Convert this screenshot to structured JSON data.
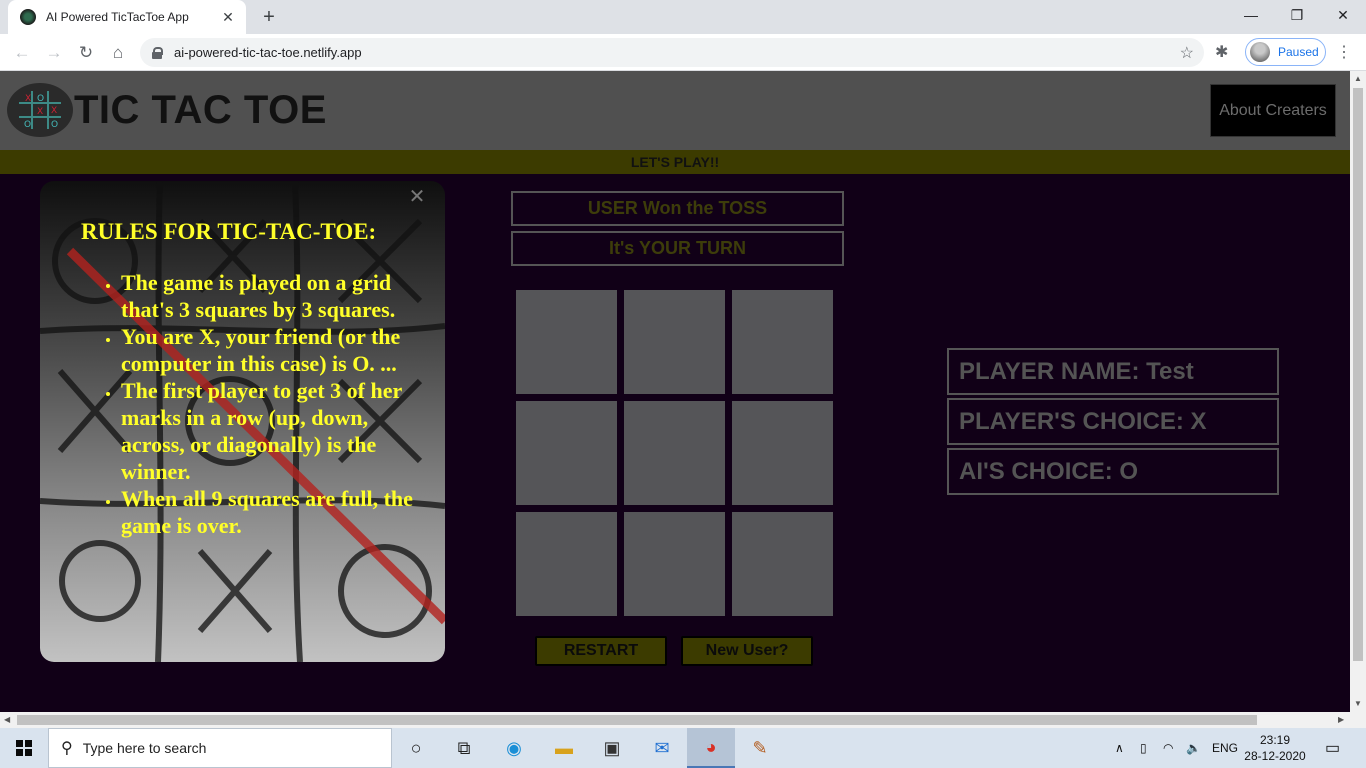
{
  "browser": {
    "tab_title": "AI Powered TicTacToe App",
    "url": "ai-powered-tic-tac-toe.netlify.app",
    "profile_status": "Paused"
  },
  "header": {
    "title": "TIC TAC TOE",
    "about_button": "About Creaters"
  },
  "banner": "LET'S PLAY!!",
  "rules": {
    "title": "RULES FOR TIC-TAC-TOE:",
    "items": [
      "The game is played on a grid that's 3 squares by 3 squares.",
      "You are X, your friend (or the computer in this case) is O. ...",
      "The first player to get 3 of her marks in a row (up, down, across, or diagonally) is the winner.",
      "When all 9 squares are full, the game is over."
    ]
  },
  "game": {
    "toss_status": "USER Won the TOSS",
    "turn_status": "It's YOUR TURN",
    "restart_button": "RESTART",
    "new_user_button": "New User?"
  },
  "player": {
    "name": "PLAYER NAME: Test",
    "choice": "PLAYER'S CHOICE: X",
    "ai_choice": "AI'S CHOICE: O"
  },
  "taskbar": {
    "search_placeholder": "Type here to search",
    "language": "ENG",
    "time": "23:19",
    "date": "28-12-2020"
  },
  "colors": {
    "page_background": "#110017",
    "accent_yellow": "#ffff29",
    "banner_olive": "#3c3b00"
  }
}
